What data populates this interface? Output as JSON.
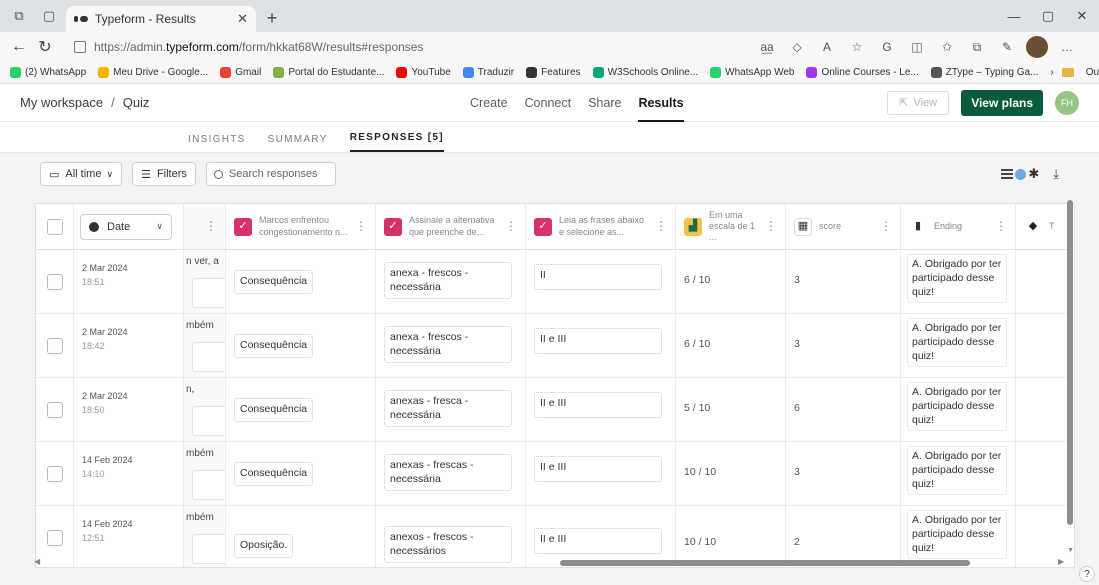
{
  "browser": {
    "tab_title": "Typeform - Results",
    "url_prefix": "https://admin.",
    "url_host": "typeform.com",
    "url_path": "/form/hkkat68W/results#responses",
    "bookmarks": [
      {
        "label": "(2) WhatsApp",
        "color": "#25d366"
      },
      {
        "label": "Meu Drive - Google...",
        "color": "#f4b400"
      },
      {
        "label": "Gmail",
        "color": "#ea4335"
      },
      {
        "label": "Portal do Estudante...",
        "color": "#7cb342"
      },
      {
        "label": "YouTube",
        "color": "#ff0000"
      },
      {
        "label": "Traduzir",
        "color": "#4285f4"
      },
      {
        "label": "Features",
        "color": "#333333"
      },
      {
        "label": "W3Schools Online...",
        "color": "#04aa6d"
      },
      {
        "label": "WhatsApp Web",
        "color": "#25d366"
      },
      {
        "label": "Online Courses - Le...",
        "color": "#a435f0"
      },
      {
        "label": "ZType – Typing Ga...",
        "color": "#555555"
      }
    ],
    "other_favorites": "Outros favoritos"
  },
  "app": {
    "breadcrumb_workspace": "My workspace",
    "breadcrumb_sep": "/",
    "breadcrumb_form": "Quiz",
    "nav": [
      "Create",
      "Connect",
      "Share",
      "Results"
    ],
    "view_label": "View",
    "plans_label": "View plans",
    "user_initials": "FH"
  },
  "subtabs": [
    "INSIGHTS",
    "SUMMARY",
    "RESPONSES [5]"
  ],
  "toolbar": {
    "time_filter": "All time",
    "filters_label": "Filters",
    "search_placeholder": "Search responses"
  },
  "columns": {
    "date": "Date",
    "marcos": "Marcos enfrentou congestionamento n...",
    "assinale": "Assinale a alternativa que preenche de...",
    "leia": "Leia as frases abaixo e selecione as...",
    "escala": "Em uma escala de 1 ...",
    "score": "score",
    "ending": "Ending",
    "last": "T"
  },
  "colors": {
    "question_pink": "#d6336c",
    "opinion_yellow": "#f2c14e",
    "brand_green": "#0a5a3c"
  },
  "rows": [
    {
      "date": "2 Mar 2024",
      "time": "18:51",
      "prev": "n ver, a",
      "marcos": "Consequência",
      "assinale": "anexa - frescos - necessária",
      "leia": "II",
      "escala": "6 / 10",
      "score": "3",
      "ending": "A. Obrigado por ter participado desse quiz!"
    },
    {
      "date": "2 Mar 2024",
      "time": "18:42",
      "prev": "mbém",
      "marcos": "Consequência",
      "assinale": "anexa - frescos - necessária",
      "leia": "II e III",
      "escala": "6 / 10",
      "score": "3",
      "ending": "A. Obrigado por ter participado desse quiz!"
    },
    {
      "date": "2 Mar 2024",
      "time": "18:50",
      "prev": "n,",
      "marcos": "Consequência",
      "assinale": "anexas - fresca - necessária",
      "leia": "II e III",
      "escala": "5 / 10",
      "score": "6",
      "ending": "A. Obrigado por ter participado desse quiz!"
    },
    {
      "date": "14 Feb 2024",
      "time": "14:10",
      "prev": "mbém",
      "marcos": "Consequência",
      "assinale": "anexas - frescas - necessária",
      "leia": "II e III",
      "escala": "10 / 10",
      "score": "3",
      "ending": "A. Obrigado por ter participado desse quiz!"
    },
    {
      "date": "14 Feb 2024",
      "time": "12:51",
      "prev": "mbém",
      "marcos": "Oposição.",
      "assinale": "anexos - frescos - necessários",
      "leia": "II e III",
      "escala": "10 / 10",
      "score": "2",
      "ending": "A. Obrigado por ter participado desse quiz!"
    }
  ]
}
